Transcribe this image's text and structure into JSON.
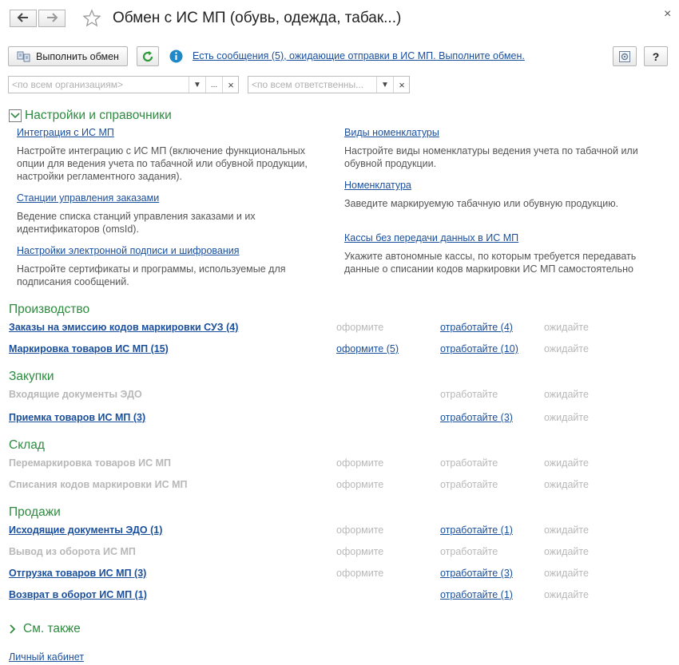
{
  "window": {
    "title": "Обмен с ИС МП (обувь, одежда, табак...)",
    "close_glyph": "×"
  },
  "toolbar": {
    "exchange_button": "Выполнить обмен",
    "info_text": "Есть сообщения (5), ожидающие отправки в ИС МП. Выполните обмен.",
    "help_label": "?"
  },
  "filters": {
    "organization_placeholder": "<по всем организациям>",
    "organization_more": "...",
    "responsible_placeholder": "<по всем ответственны...",
    "clear_glyph": "×"
  },
  "settings": {
    "title": "Настройки и справочники",
    "left": [
      {
        "link": "Интеграция с ИС МП",
        "desc": "Настройте интеграцию с ИС МП (включение функциональных опции для ведения учета по табачной или обувной продукции, настройки регламентного задания)."
      },
      {
        "link": "Станции управления заказами",
        "desc": "Ведение списка станций управления заказами и их идентификаторов (omsId)."
      },
      {
        "link": "Настройки электронной подписи и шифрования",
        "desc": "Настройте сертификаты и программы, используемые для подписания сообщений."
      }
    ],
    "right": [
      {
        "link": "Виды номенклатуры",
        "desc": "Настройте виды номенклатуры ведения учета по табачной или обувной продукции."
      },
      {
        "link": "Номенклатура",
        "desc": "Заведите маркируемую табачную или обувную продукцию."
      },
      {
        "link": "Кассы без передачи данных в ИС МП",
        "desc": "Укажите автономные кассы, по которым требуется передавать данные о списании кодов маркировки ИС МП самостоятельно"
      }
    ]
  },
  "sections": {
    "production": {
      "title": "Производство",
      "rows": [
        {
          "name": "Заказы на эмиссию кодов маркировки СУЗ (4)",
          "c1": "оформите",
          "c2": "отработайте (4)",
          "c3": "ожидайте"
        },
        {
          "name": "Маркировка товаров ИС МП (15)",
          "c1": "оформите (5)",
          "c2": "отработайте (10)",
          "c3": "ожидайте"
        }
      ]
    },
    "purchases": {
      "title": "Закупки",
      "rows": [
        {
          "name": "Входящие документы ЭДО",
          "c2": "отработайте",
          "c3": "ожидайте"
        },
        {
          "name": "Приемка товаров ИС МП (3)",
          "c2": "отработайте (3)",
          "c3": "ожидайте"
        }
      ]
    },
    "warehouse": {
      "title": "Склад",
      "rows": [
        {
          "name": "Перемаркировка товаров ИС МП",
          "c1": "оформите",
          "c2": "отработайте",
          "c3": "ожидайте"
        },
        {
          "name": "Списания кодов маркировки ИС МП",
          "c1": "оформите",
          "c2": "отработайте",
          "c3": "ожидайте"
        }
      ]
    },
    "sales": {
      "title": "Продажи",
      "rows": [
        {
          "name": "Исходящие документы ЭДО (1)",
          "c1": "оформите",
          "c2": "отработайте (1)",
          "c3": "ожидайте"
        },
        {
          "name": "Вывод из оборота ИС МП",
          "c1": "оформите",
          "c2": "отработайте",
          "c3": "ожидайте"
        },
        {
          "name": "Отгрузка товаров ИС МП (3)",
          "c1": "оформите",
          "c2": "отработайте (3)",
          "c3": "ожидайте"
        },
        {
          "name": "Возврат в оборот ИС МП (1)",
          "c2": "отработайте (1)",
          "c3": "ожидайте"
        }
      ]
    }
  },
  "see_also": {
    "title": "См. также"
  },
  "footer": {
    "personal_cabinet": "Личный кабинет"
  },
  "colors": {
    "accent_green": "#2e8b3f",
    "link_blue": "#1a4f9c",
    "info_blue": "#1e88c8",
    "muted": "#b8b8b8"
  }
}
